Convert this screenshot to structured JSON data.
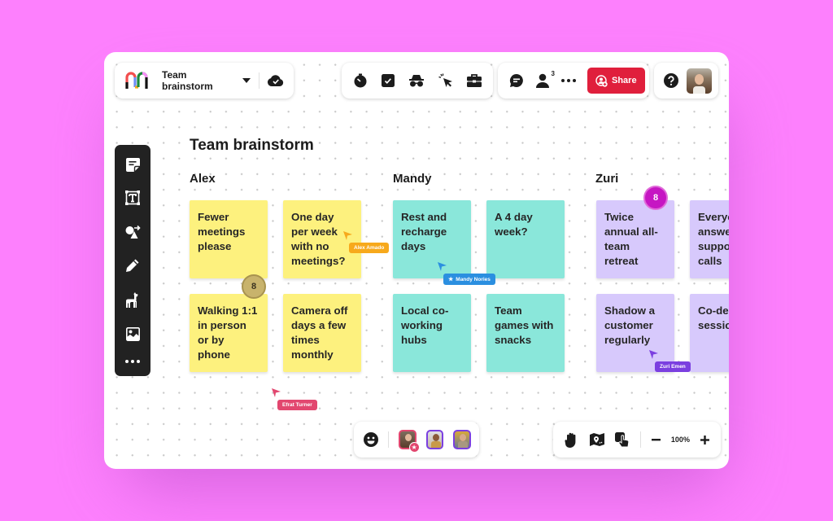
{
  "header": {
    "board_name": "Team brainstorm",
    "share_label": "Share",
    "collaborator_count": "3"
  },
  "board": {
    "title": "Team brainstorm",
    "columns": [
      {
        "name": "Alex",
        "color": "#fdf17e",
        "notes": [
          "Fewer meetings please",
          "One day per week with no meetings?",
          "Walking 1:1 in person or by phone",
          "Camera off days a few times monthly"
        ]
      },
      {
        "name": "Mandy",
        "color": "#8ae7da",
        "notes": [
          "Rest and recharge days",
          "A 4 day week?",
          "Local co-working hubs",
          "Team games with snacks"
        ]
      },
      {
        "name": "Zuri",
        "color": "#d7c9fc",
        "notes": [
          "Twice annual all-team retreat",
          "Everyone answer support calls",
          "Shadow a customer regularly",
          "Co-design sessions"
        ]
      }
    ],
    "votes": [
      {
        "target": "Walking 1:1 in person or by phone",
        "count": "8",
        "color": "#c8b36c"
      },
      {
        "target": "Twice annual all-team retreat",
        "count": "8",
        "color": "#c616c3"
      }
    ],
    "cursors": [
      {
        "name": "Alex Amado",
        "color": "#f7a91c"
      },
      {
        "name": "Mandy Nories",
        "color": "#2b8fe0",
        "badge": "star"
      },
      {
        "name": "Zuri Emen",
        "color": "#7b3fe0"
      },
      {
        "name": "Efrat Turner",
        "color": "#e2476f"
      }
    ]
  },
  "left_toolbar": {
    "tools": [
      "sticky-note",
      "text",
      "shapes",
      "pen",
      "llama-templates",
      "image",
      "more"
    ]
  },
  "top_toolbar": {
    "tools": [
      "timer",
      "voting",
      "private-mode",
      "cursor-attention",
      "toolkit"
    ]
  },
  "bottom": {
    "zoom_level": "100%",
    "participants": [
      "Efrat Turner",
      "Mandy Nories",
      "Zuri Emen"
    ]
  }
}
